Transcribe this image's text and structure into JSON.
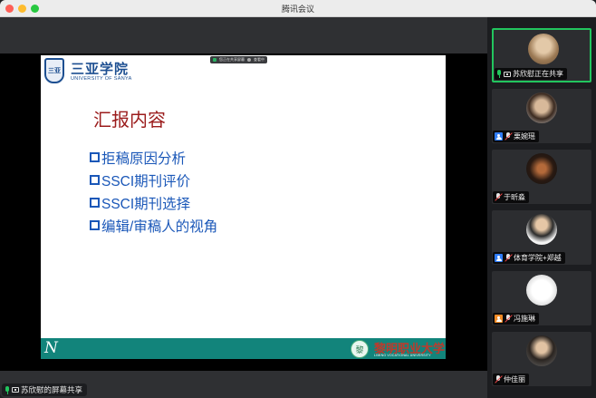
{
  "window": {
    "title": "腾讯会议"
  },
  "sharing_pill": {
    "text": "您正在共享屏幕",
    "viewer": "查看中"
  },
  "slide": {
    "logo_crest": "三亚",
    "logo_cn": "三亚学院",
    "logo_en": "UNIVERSITY OF SANYA",
    "title": "汇报内容",
    "bullets": [
      "拒稿原因分析",
      "SSCI期刊评价",
      "SSCI期刊选择",
      "编辑/审稿人的视角"
    ],
    "footer_n": "N",
    "footer_emblem": "黎",
    "footer_cn": "黎明职业大学",
    "footer_en": "LIMING VOCATIONAL UNIVERSITY"
  },
  "share_label": {
    "text": "苏欣慰的屏幕共享"
  },
  "participants": [
    {
      "name": "苏欣慰正在共享",
      "mic": "on",
      "badge": "screen",
      "avatar": "photo",
      "active": true
    },
    {
      "name": "栗婉瑶",
      "mic": "off",
      "badge": "user-blue",
      "avatar": "photo",
      "active": false
    },
    {
      "name": "于昕淼",
      "mic": "off",
      "badge": "none",
      "avatar": "photo",
      "active": false
    },
    {
      "name": "体育学院+郑越",
      "mic": "off",
      "badge": "user-blue",
      "avatar": "photo",
      "active": false
    },
    {
      "name": "冯施琳",
      "mic": "off",
      "badge": "user-orange",
      "avatar": "photo",
      "active": false
    },
    {
      "name": "仲佳丽",
      "mic": "off",
      "badge": "none",
      "avatar": "photo",
      "active": false
    }
  ],
  "colors": {
    "accent_green": "#22c55e",
    "slide_title": "#9b1c1c",
    "bullet_blue": "#1a57b8",
    "footer_teal": "#12847b"
  }
}
